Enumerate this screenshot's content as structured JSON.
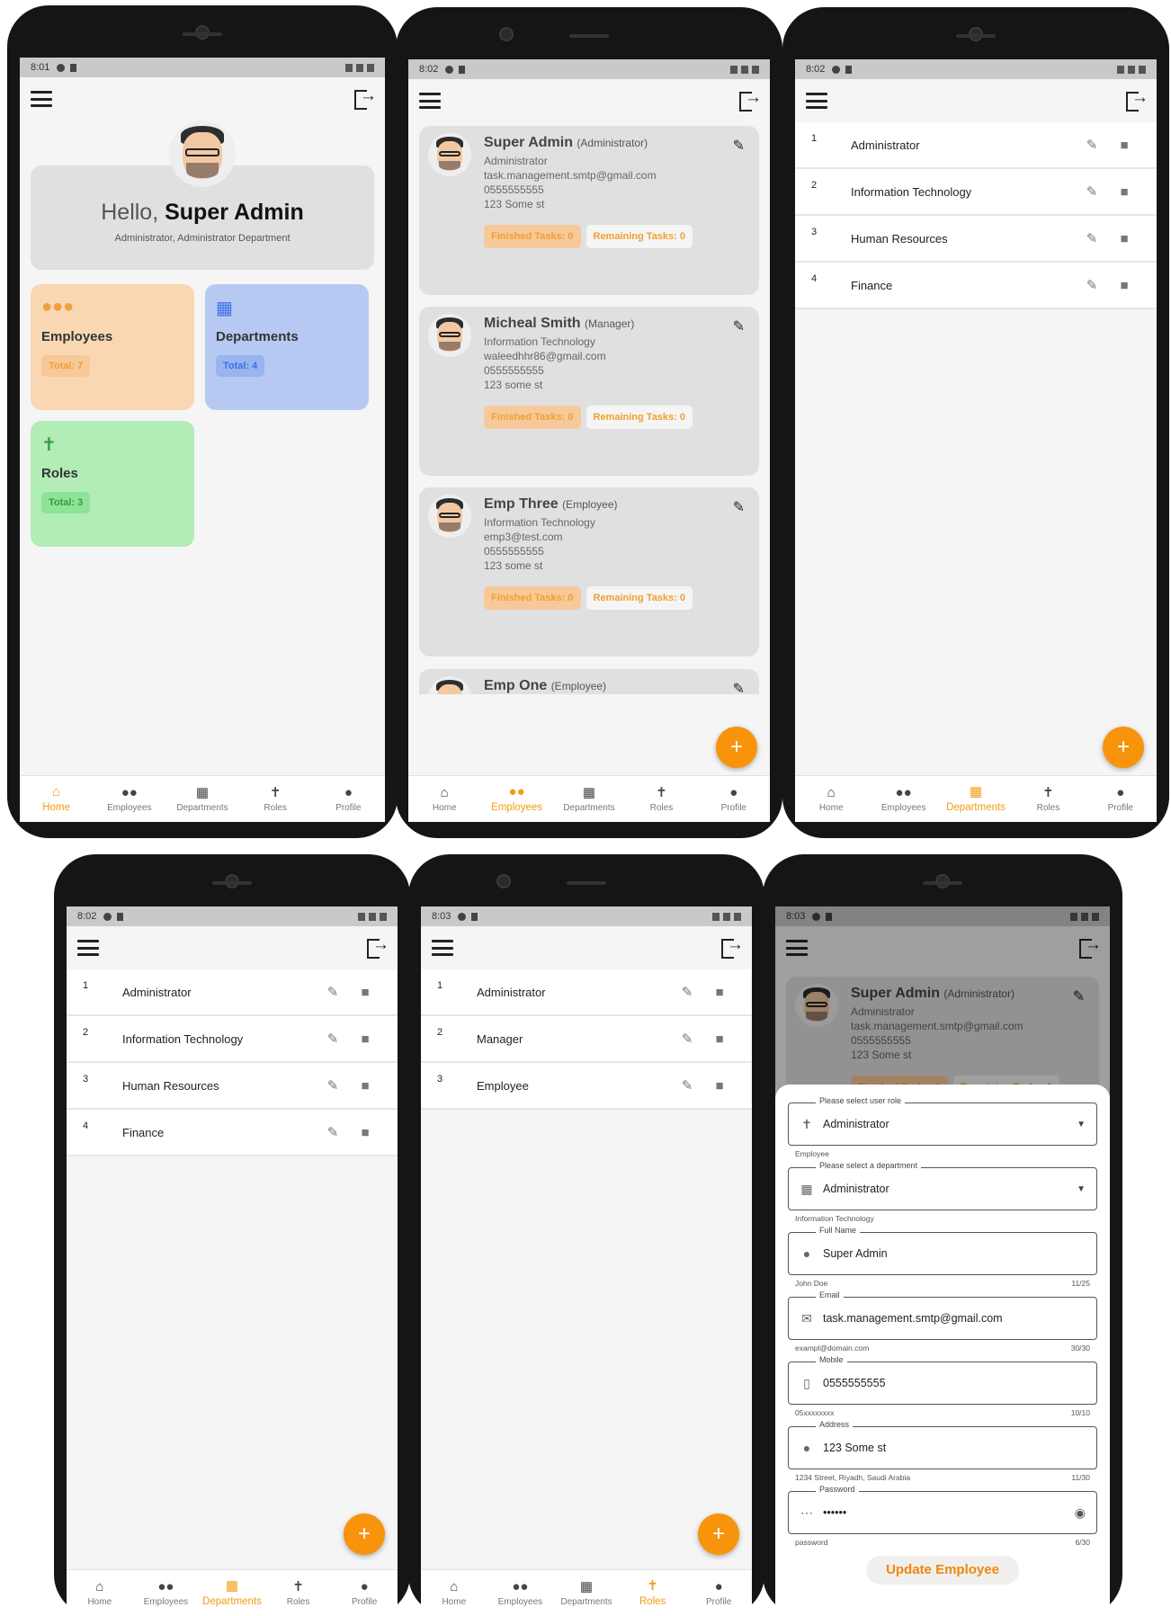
{
  "status": {
    "p1": "8:01",
    "p2": "8:02",
    "p3": "8:02",
    "p4": "8:02",
    "p5": "8:03",
    "p6": "8:03"
  },
  "nav": {
    "home": "Home",
    "employees": "Employees",
    "departments": "Departments",
    "roles": "Roles",
    "profile": "Profile"
  },
  "home": {
    "hello": "Hello,",
    "name": "Super Admin",
    "sub": "Administrator, Administrator Department",
    "tiles": {
      "employees": {
        "label": "Employees",
        "total": "Total: 7"
      },
      "departments": {
        "label": "Departments",
        "total": "Total: 4"
      },
      "roles": {
        "label": "Roles",
        "total": "Total: 3"
      }
    }
  },
  "employees": [
    {
      "name": "Super Admin",
      "role": "(Administrator)",
      "dept": "Administrator",
      "email": "task.management.smtp@gmail.com",
      "mobile": "0555555555",
      "address": "123 Some st",
      "finished": "Finished Tasks: 0",
      "remaining": "Remaining Tasks: 0"
    },
    {
      "name": "Micheal Smith",
      "role": "(Manager)",
      "dept": "Information Technology",
      "email": "waleedhhr86@gmail.com",
      "mobile": "0555555555",
      "address": "123 some st",
      "finished": "Finished Tasks: 0",
      "remaining": "Remaining Tasks: 0"
    },
    {
      "name": "Emp Three",
      "role": "(Employee)",
      "dept": "Information Technology",
      "email": "emp3@test.com",
      "mobile": "0555555555",
      "address": "123 some st",
      "finished": "Finished Tasks: 0",
      "remaining": "Remaining Tasks: 0"
    },
    {
      "name": "Emp One",
      "role": "(Employee)"
    }
  ],
  "departments": [
    {
      "idx": "1",
      "name": "Administrator"
    },
    {
      "idx": "2",
      "name": "Information Technology"
    },
    {
      "idx": "3",
      "name": "Human Resources"
    },
    {
      "idx": "4",
      "name": "Finance"
    }
  ],
  "roles": [
    {
      "idx": "1",
      "name": "Administrator"
    },
    {
      "idx": "2",
      "name": "Manager"
    },
    {
      "idx": "3",
      "name": "Employee"
    }
  ],
  "fab": "+",
  "form": {
    "role": {
      "label": "Please select user role",
      "value": "Administrator",
      "helper": "Employee"
    },
    "dept": {
      "label": "Please select a department",
      "value": "Administrator",
      "helper": "Information Technology"
    },
    "name": {
      "label": "Full Name",
      "value": "Super Admin",
      "helper": "John Doe",
      "count": "11/25"
    },
    "email": {
      "label": "Email",
      "value": "task.management.smtp@gmail.com",
      "helper": "exampl@domain.com",
      "count": "30/30"
    },
    "mobile": {
      "label": "Mobile",
      "value": "0555555555",
      "helper": "05xxxxxxxx",
      "count": "10/10"
    },
    "address": {
      "label": "Address",
      "value": "123 Some st",
      "helper": "1234 Street, Riyadh, Saudi Arabia",
      "count": "11/30"
    },
    "password": {
      "label": "Password",
      "value": "••••••",
      "helper": "password",
      "count": "6/30"
    },
    "submit": "Update Employee"
  }
}
